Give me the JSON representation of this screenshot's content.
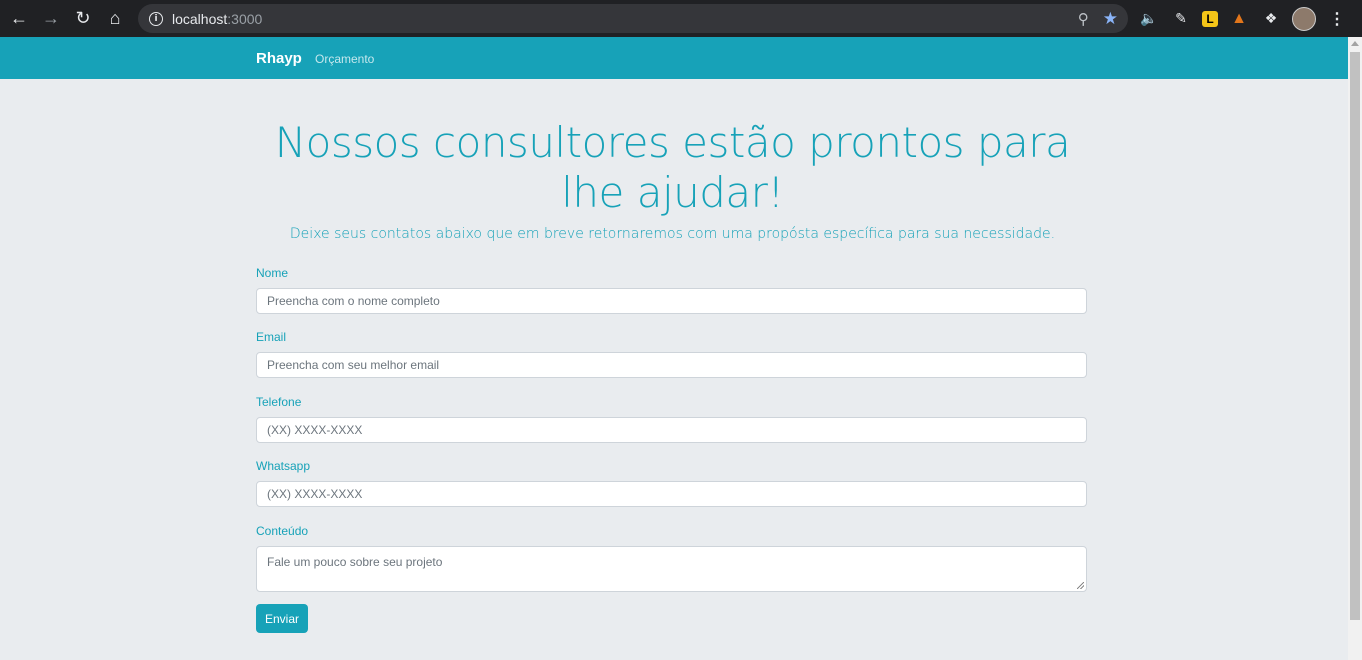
{
  "browser": {
    "url_host": "localhost",
    "url_port": ":3000",
    "icons": {
      "back": "back-arrow-icon",
      "forward": "forward-arrow-icon",
      "reload": "reload-icon",
      "home": "home-icon",
      "info": "info-icon",
      "zoom": "zoom-icon",
      "bookmark": "star-icon",
      "extensions": [
        "speaker-icon",
        "pen-extension-icon",
        "l-extension-icon",
        "metamask-fox-icon",
        "puzzle-icon",
        "avatar",
        "menu-dots-icon"
      ]
    },
    "ext_l_label": "L"
  },
  "navbar": {
    "brand": "Rhayp",
    "link": "Orçamento",
    "color": "#17a2b8"
  },
  "main": {
    "title": "Nossos consultores estão prontos para lhe ajudar!",
    "subtitle": "Deixe seus contatos abaixo que em breve retornaremos com uma propósta específica para sua necessidade."
  },
  "form": {
    "fields": [
      {
        "label": "Nome",
        "placeholder": "Preencha com o nome completo"
      },
      {
        "label": "Email",
        "placeholder": "Preencha com seu melhor email"
      },
      {
        "label": "Telefone",
        "placeholder": "(XX) XXXX-XXXX"
      },
      {
        "label": "Whatsapp",
        "placeholder": "(XX) XXXX-XXXX"
      },
      {
        "label": "Conteúdo",
        "placeholder": "Fale um pouco sobre seu projeto"
      }
    ],
    "submit_label": "Enviar"
  }
}
